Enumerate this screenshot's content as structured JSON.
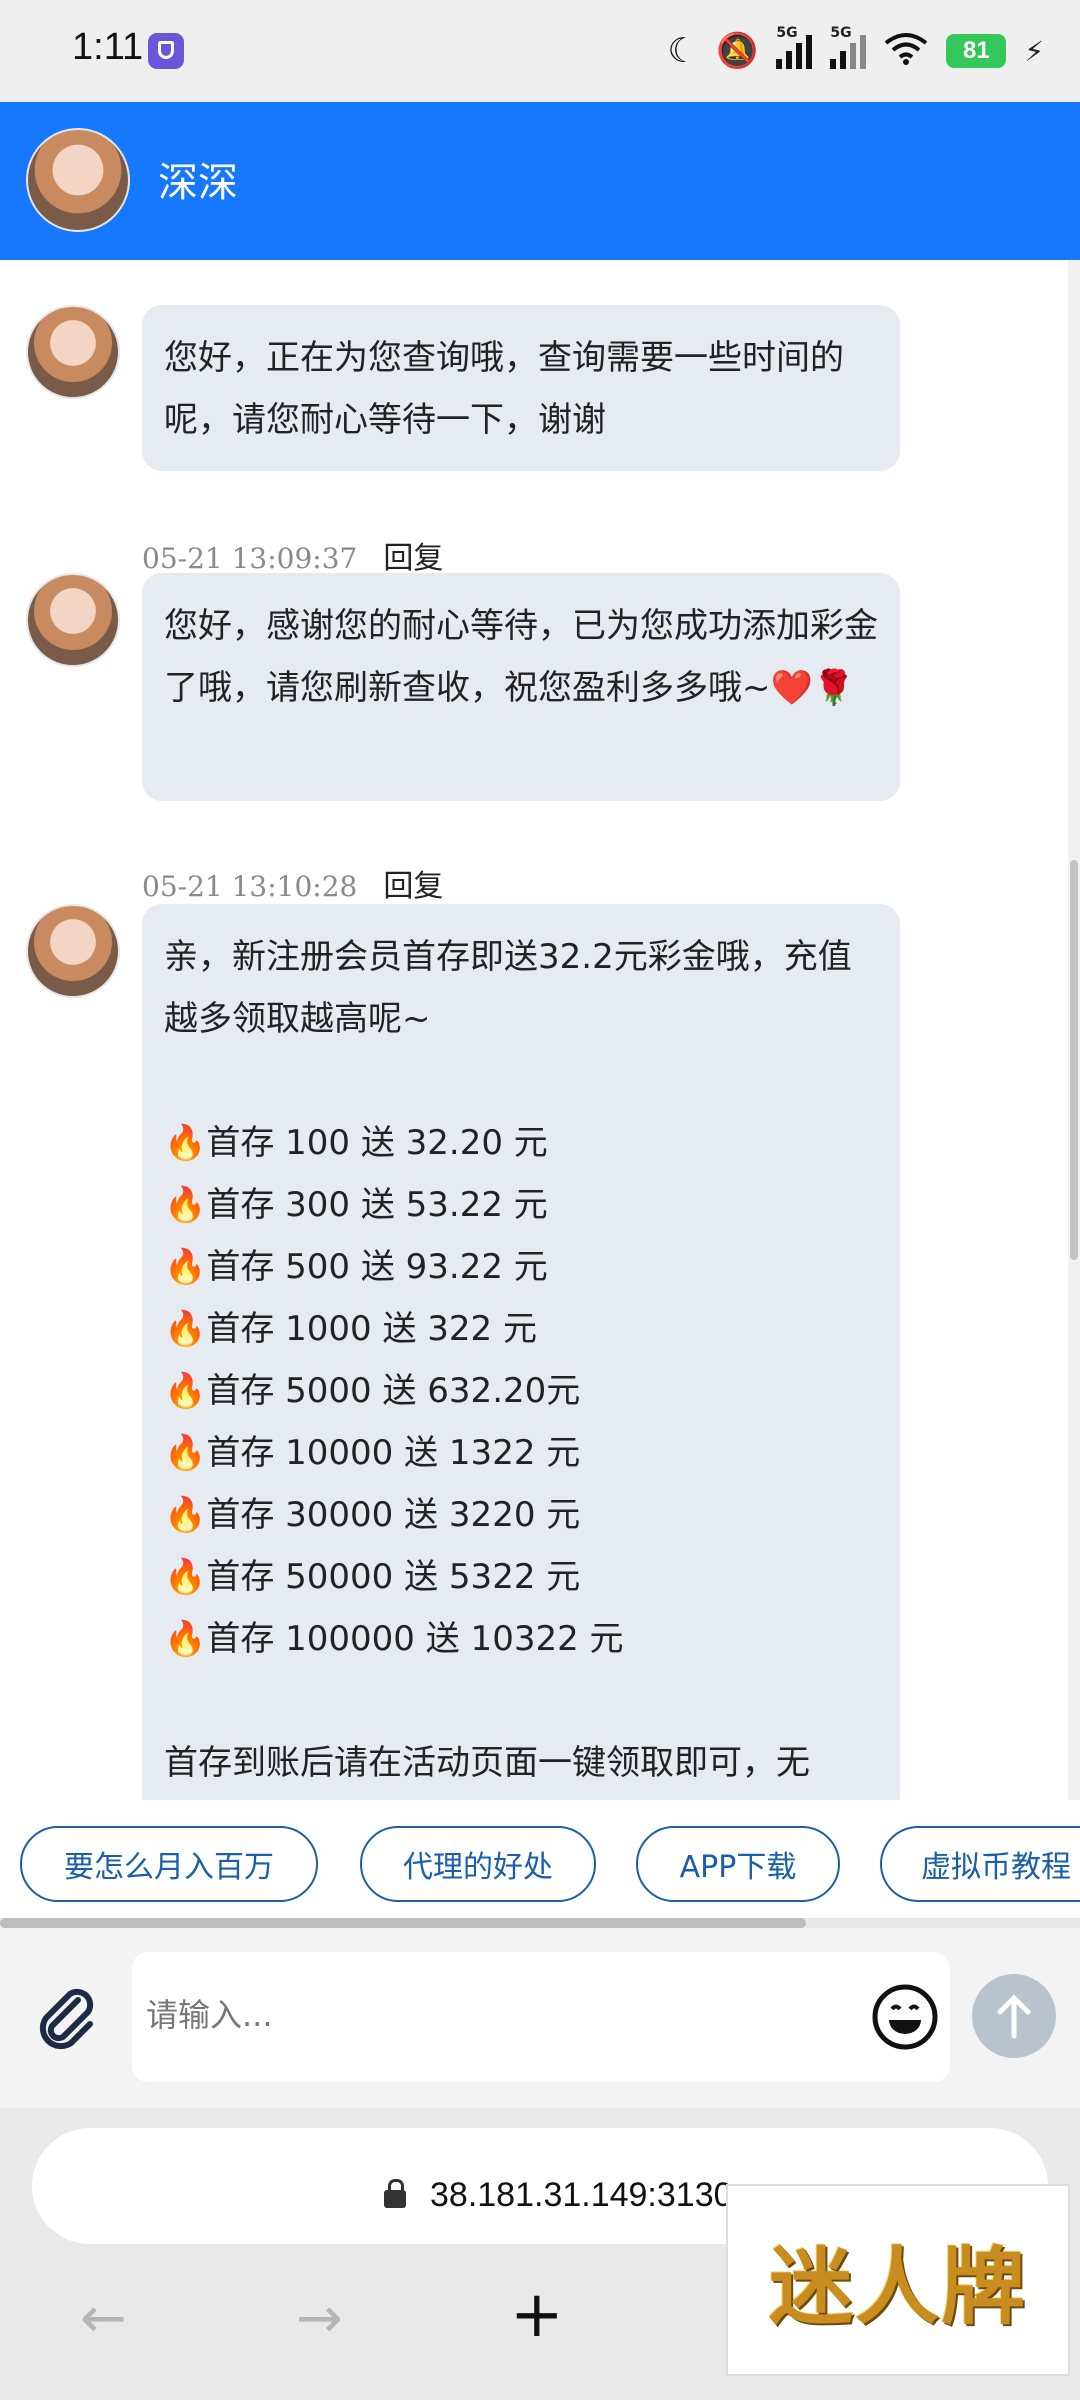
{
  "status_bar": {
    "time": "1:11",
    "battery": "81",
    "icons": [
      "vpn-shield-icon",
      "moon-icon",
      "mute-icon",
      "signal-5g-icon",
      "signal-5g-icon",
      "wifi-icon",
      "battery-icon",
      "charging-icon"
    ],
    "signal_label": "5G"
  },
  "header": {
    "name": "深深",
    "bg_color": "#1677ff"
  },
  "messages": [
    {
      "text": "您好，正在为您查询哦，查询需要一些时间的呢，请您耐心等待一下，谢谢",
      "time": "05-21 13:09:37",
      "reply_label": "回复"
    },
    {
      "text": "您好，感谢您的耐心等待，已为您成功添加彩金了哦，请您刷新查收，祝您盈利多多哦~❤️🌹",
      "time": "05-21 13:10:28",
      "reply_label": "回复"
    },
    {
      "intro": "亲，新注册会员首存即送32.2元彩金哦，充值越多领取越高呢~",
      "lines": [
        "首存 100 送 32.20 元",
        "首存 300 送 53.22 元",
        "首存 500 送 93.22 元",
        "首存 1000 送 322 元",
        "首存 5000 送 632.20元",
        "首存 10000 送 1322 元",
        "首存 30000 送 3220 元",
        "首存 50000 送 5322 元",
        "首存 100000 送 10322 元"
      ],
      "footer": "首存到账后请在活动页面一键领取即可，无"
    }
  ],
  "quick_replies": [
    "要怎么月入百万",
    "代理的好处",
    "APP下载",
    "虚拟币教程"
  ],
  "input": {
    "placeholder": "请输入..."
  },
  "browser": {
    "url": "38.181.31.149:3130"
  },
  "watermark": "迷人牌"
}
